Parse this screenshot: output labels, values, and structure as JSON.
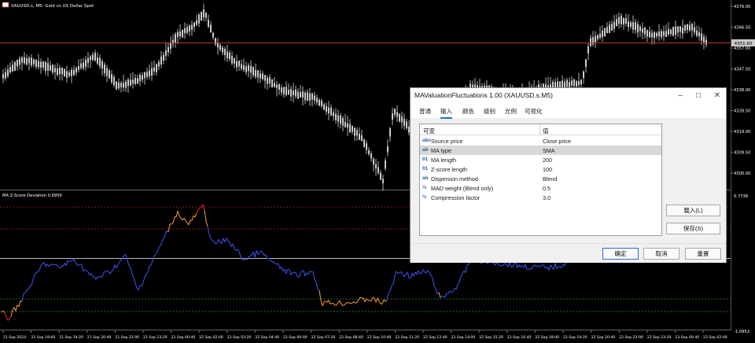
{
  "chart": {
    "symbol_label": "XAUUSD.s, M5: Gold vs US Dollar Spot",
    "current_price": "4351.60",
    "price_ticks": [
      "4376.00",
      "4366.50",
      "4357.00",
      "4347.50",
      "4338.00",
      "4328.50",
      "4319.00",
      "4309.50",
      "4300.00"
    ],
    "indicator_label": "MA Z-Score Deviation 0.6956",
    "indicator_ticks": [
      "0.7738",
      "-1.0952"
    ],
    "time_ticks": [
      "21 Sep 2024",
      "21 Sep 18:00",
      "21 Sep 19:20",
      "21 Sep 20:40",
      "21 Sep 22:00",
      "21 Sep 23:20",
      "22 Sep 00:40",
      "22 Sep 02:00",
      "22 Sep 03:20",
      "22 Sep 04:40",
      "22 Sep 06:00",
      "22 Sep 07:20",
      "22 Sep 08:40",
      "22 Sep 10:00",
      "22 Sep 11:20",
      "22 Sep 12:40",
      "22 Sep 14:00",
      "22 Sep 15:20",
      "22 Sep 16:40",
      "22 Sep 18:00",
      "22 Sep 19:20",
      "22 Sep 20:40",
      "22 Sep 22:00",
      "22 Sep 23:20",
      "23 Sep 00:40",
      "23 Sep 02:00"
    ],
    "colors": {
      "background": "#000000",
      "candle": "#ffffff",
      "price_line": "#c03030",
      "z_normal": "#3a4fe0",
      "z_warm": "#e8922a",
      "z_hot": "#e02020",
      "level_upper": "#b02020",
      "level_lower": "#2f8f2f",
      "zero_line": "#bbbbbb"
    }
  },
  "dialog": {
    "title": "MAValuationFluctuations 1.00 (XAUUSD.s,M5)",
    "tabs": [
      "普通",
      "输入",
      "颜色",
      "级别",
      "光例",
      "可视化"
    ],
    "active_tab": 1,
    "table": {
      "col_variable": "可变",
      "col_value": "值",
      "rows": [
        {
          "icon": "abc",
          "name": "Source price",
          "value": "Close price"
        },
        {
          "icon": "ab",
          "name": "MA type",
          "value": "SMA"
        },
        {
          "icon": "01",
          "name": "MA length",
          "value": "200"
        },
        {
          "icon": "01",
          "name": "Z-score length",
          "value": "100"
        },
        {
          "icon": "ab",
          "name": "Dispersion method",
          "value": "Blend"
        },
        {
          "icon": "½",
          "name": "MAD weight (Blend only)",
          "value": "0.5"
        },
        {
          "icon": "½",
          "name": "Compression factor",
          "value": "3.0"
        }
      ],
      "selected_row": 1
    },
    "load_button": "载入(L)",
    "save_button": "保存(S)",
    "ok_button": "确定",
    "cancel_button": "取消",
    "reset_button": "重置"
  }
}
